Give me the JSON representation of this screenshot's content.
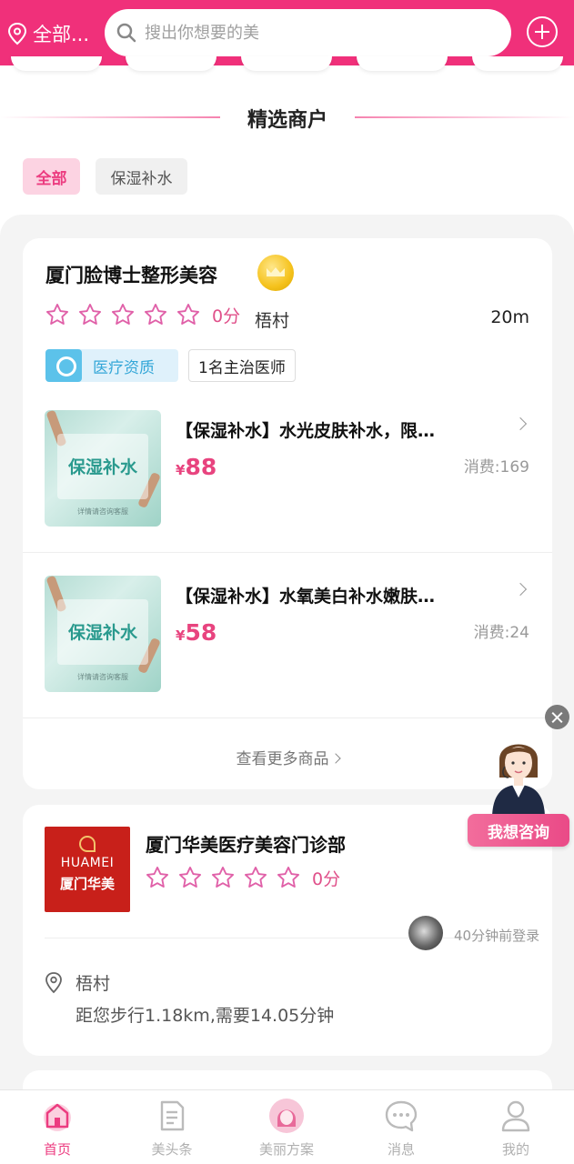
{
  "header": {
    "location": "全部...",
    "search_placeholder": "搜出你想要的美"
  },
  "section_title": "精选商户",
  "filters": {
    "all": "全部",
    "moisturize": "保湿补水"
  },
  "shop1": {
    "name": "厦门脸博士整形美容",
    "score": "0分",
    "area": "梧村",
    "distance": "20m",
    "badge_medical": "医疗资质",
    "badge_doctor": "1名主治医师",
    "products": [
      {
        "image_text": "保湿补水",
        "image_sub": "详情请咨询客服",
        "title": "【保湿补水】水光皮肤补水，限…",
        "currency": "¥",
        "price": "88",
        "sold": "消费:169"
      },
      {
        "image_text": "保湿补水",
        "image_sub": "详情请咨询客服",
        "title": "【保湿补水】水氧美白补水嫩肤…",
        "currency": "¥",
        "price": "58",
        "sold": "消费:24"
      }
    ],
    "more_label": "查看更多商品"
  },
  "shop2": {
    "logo_en": "HUAMEI",
    "logo_cn": "厦门华美",
    "name": "厦门华美医疗美容门诊部",
    "score": "0分",
    "login_status": "40分钟前登录",
    "area": "梧村",
    "route": "距您步行1.18km,需要14.05分钟"
  },
  "consult": {
    "label": "我想咨询"
  },
  "tabbar": {
    "items": [
      {
        "label": "首页",
        "icon": "home-icon",
        "active": true
      },
      {
        "label": "美头条",
        "icon": "document-icon",
        "active": false
      },
      {
        "label": "美丽方案",
        "icon": "beauty-avatar-icon",
        "active": false
      },
      {
        "label": "消息",
        "icon": "message-icon",
        "active": false
      },
      {
        "label": "我的",
        "icon": "user-icon",
        "active": false
      }
    ]
  },
  "colors": {
    "brand": "#f0307a",
    "price": "#e8447f",
    "star": "#e060a8"
  }
}
